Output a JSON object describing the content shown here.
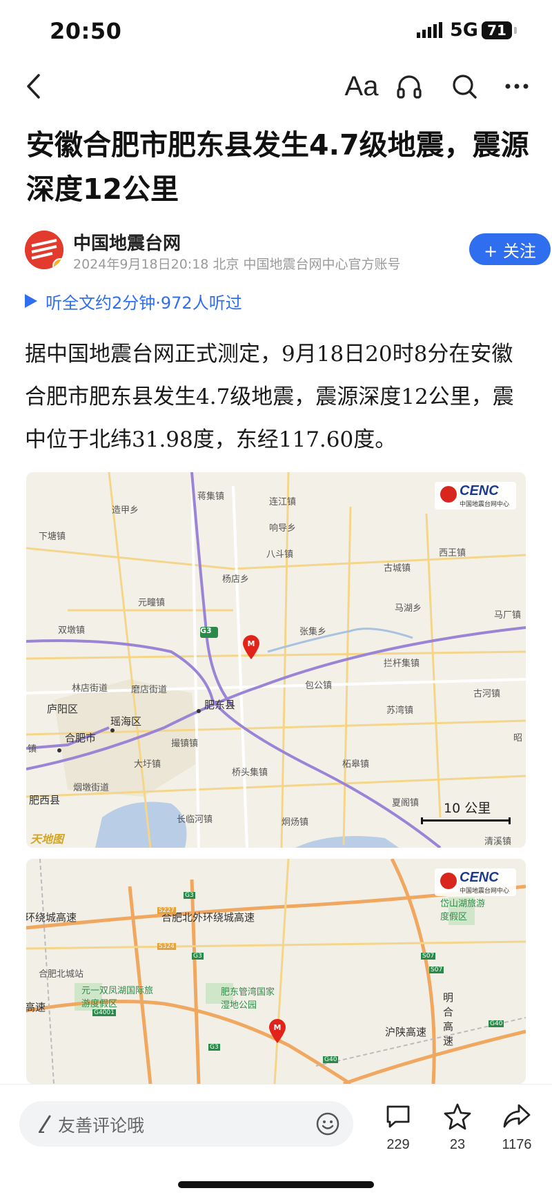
{
  "status_bar": {
    "time": "20:50",
    "network": "5G",
    "battery": "71"
  },
  "nav": {
    "font_label": "Aa"
  },
  "article": {
    "title": "安徽合肥市肥东县发生4.7级地震，震源深度12公里",
    "author": {
      "name": "中国地震台网",
      "meta": "2024年9月18日20:18 北京 中国地震台网中心官方账号"
    },
    "follow_label": "+ 关注",
    "listen_label": "听全文约2分钟·972人听过",
    "body": "据中国地震台网正式测定，9月18日20时8分在安徽合肥市肥东县发生4.7级地震，震源深度12公里，震中位于北纬31.98度，东经117.60度。"
  },
  "map1": {
    "logo_text": "CENC",
    "logo_sub": "中国地震台网中心",
    "scale_label": "10 公里",
    "watermark": "天地图",
    "road_label": "G3",
    "places": [
      "蒋集镇",
      "连江镇",
      "造甲乡",
      "响导乡",
      "下塘镇",
      "八斗镇",
      "西王镇",
      "古城镇",
      "杨店乡",
      "元疃镇",
      "马湖乡",
      "马厂镇",
      "双墩镇",
      "张集乡",
      "拦杆集镇",
      "包公镇",
      "林店街道",
      "磨店街道",
      "古河镇",
      "庐阳区",
      "肥东县",
      "瑶海区",
      "苏湾镇",
      "合肥市",
      "昭",
      "撮镇镇",
      "镇",
      "大圩镇",
      "桥头集镇",
      "柘皋镇",
      "烟墩街道",
      "肥西县",
      "长临河镇",
      "炯炀镇",
      "夏阁镇",
      "清溪镇"
    ]
  },
  "map2": {
    "logo_text": "CENC",
    "logo_sub": "中国地震台网中心",
    "places": [
      "环绕城高速",
      "合肥北外环绕城高速",
      "岱山湖旅游度假区",
      "合肥北城站",
      "元一双凤湖国际旅游度假区",
      "肥东管湾国家湿地公园",
      "高速",
      "明合高速",
      "沪陕高速"
    ],
    "roads": [
      "S227",
      "G3",
      "S324",
      "G3",
      "G4001",
      "G3",
      "S07",
      "S07",
      "G40",
      "G40"
    ]
  },
  "bottom_bar": {
    "comment_placeholder": "友善评论哦",
    "comments": "229",
    "favorites": "23",
    "shares": "1176"
  }
}
